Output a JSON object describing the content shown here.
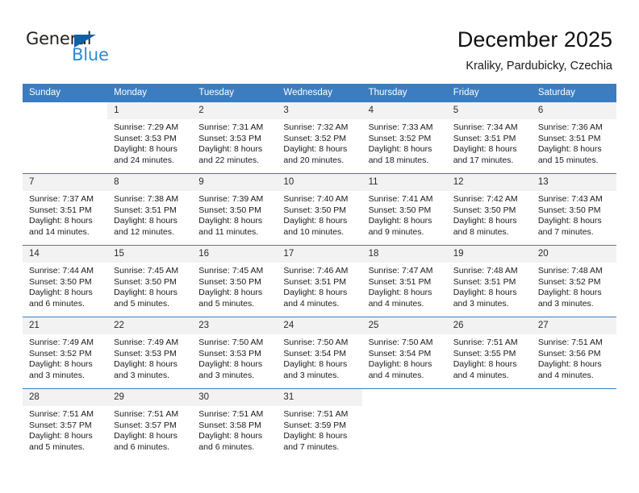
{
  "brand": {
    "name_part1": "General",
    "name_part2": "Blue",
    "accent_color": "#1060a8",
    "blue_text_color": "#2b8bd6"
  },
  "header": {
    "title": "December 2025",
    "subtitle": "Kraliky, Pardubicky, Czechia"
  },
  "calendar": {
    "header_bg": "#3b7dc0",
    "daynum_bg": "#f2f2f2",
    "weekdays": [
      "Sunday",
      "Monday",
      "Tuesday",
      "Wednesday",
      "Thursday",
      "Friday",
      "Saturday"
    ],
    "weeks": [
      [
        {
          "day": "",
          "blank": true,
          "sunrise": "",
          "sunset": "",
          "daylight1": "",
          "daylight2": ""
        },
        {
          "day": "1",
          "sunrise": "Sunrise: 7:29 AM",
          "sunset": "Sunset: 3:53 PM",
          "daylight1": "Daylight: 8 hours",
          "daylight2": "and 24 minutes."
        },
        {
          "day": "2",
          "sunrise": "Sunrise: 7:31 AM",
          "sunset": "Sunset: 3:53 PM",
          "daylight1": "Daylight: 8 hours",
          "daylight2": "and 22 minutes."
        },
        {
          "day": "3",
          "sunrise": "Sunrise: 7:32 AM",
          "sunset": "Sunset: 3:52 PM",
          "daylight1": "Daylight: 8 hours",
          "daylight2": "and 20 minutes."
        },
        {
          "day": "4",
          "sunrise": "Sunrise: 7:33 AM",
          "sunset": "Sunset: 3:52 PM",
          "daylight1": "Daylight: 8 hours",
          "daylight2": "and 18 minutes."
        },
        {
          "day": "5",
          "sunrise": "Sunrise: 7:34 AM",
          "sunset": "Sunset: 3:51 PM",
          "daylight1": "Daylight: 8 hours",
          "daylight2": "and 17 minutes."
        },
        {
          "day": "6",
          "sunrise": "Sunrise: 7:36 AM",
          "sunset": "Sunset: 3:51 PM",
          "daylight1": "Daylight: 8 hours",
          "daylight2": "and 15 minutes."
        }
      ],
      [
        {
          "day": "7",
          "sunrise": "Sunrise: 7:37 AM",
          "sunset": "Sunset: 3:51 PM",
          "daylight1": "Daylight: 8 hours",
          "daylight2": "and 14 minutes."
        },
        {
          "day": "8",
          "sunrise": "Sunrise: 7:38 AM",
          "sunset": "Sunset: 3:51 PM",
          "daylight1": "Daylight: 8 hours",
          "daylight2": "and 12 minutes."
        },
        {
          "day": "9",
          "sunrise": "Sunrise: 7:39 AM",
          "sunset": "Sunset: 3:50 PM",
          "daylight1": "Daylight: 8 hours",
          "daylight2": "and 11 minutes."
        },
        {
          "day": "10",
          "sunrise": "Sunrise: 7:40 AM",
          "sunset": "Sunset: 3:50 PM",
          "daylight1": "Daylight: 8 hours",
          "daylight2": "and 10 minutes."
        },
        {
          "day": "11",
          "sunrise": "Sunrise: 7:41 AM",
          "sunset": "Sunset: 3:50 PM",
          "daylight1": "Daylight: 8 hours",
          "daylight2": "and 9 minutes."
        },
        {
          "day": "12",
          "sunrise": "Sunrise: 7:42 AM",
          "sunset": "Sunset: 3:50 PM",
          "daylight1": "Daylight: 8 hours",
          "daylight2": "and 8 minutes."
        },
        {
          "day": "13",
          "sunrise": "Sunrise: 7:43 AM",
          "sunset": "Sunset: 3:50 PM",
          "daylight1": "Daylight: 8 hours",
          "daylight2": "and 7 minutes."
        }
      ],
      [
        {
          "day": "14",
          "sunrise": "Sunrise: 7:44 AM",
          "sunset": "Sunset: 3:50 PM",
          "daylight1": "Daylight: 8 hours",
          "daylight2": "and 6 minutes."
        },
        {
          "day": "15",
          "sunrise": "Sunrise: 7:45 AM",
          "sunset": "Sunset: 3:50 PM",
          "daylight1": "Daylight: 8 hours",
          "daylight2": "and 5 minutes."
        },
        {
          "day": "16",
          "sunrise": "Sunrise: 7:45 AM",
          "sunset": "Sunset: 3:50 PM",
          "daylight1": "Daylight: 8 hours",
          "daylight2": "and 5 minutes."
        },
        {
          "day": "17",
          "sunrise": "Sunrise: 7:46 AM",
          "sunset": "Sunset: 3:51 PM",
          "daylight1": "Daylight: 8 hours",
          "daylight2": "and 4 minutes."
        },
        {
          "day": "18",
          "sunrise": "Sunrise: 7:47 AM",
          "sunset": "Sunset: 3:51 PM",
          "daylight1": "Daylight: 8 hours",
          "daylight2": "and 4 minutes."
        },
        {
          "day": "19",
          "sunrise": "Sunrise: 7:48 AM",
          "sunset": "Sunset: 3:51 PM",
          "daylight1": "Daylight: 8 hours",
          "daylight2": "and 3 minutes."
        },
        {
          "day": "20",
          "sunrise": "Sunrise: 7:48 AM",
          "sunset": "Sunset: 3:52 PM",
          "daylight1": "Daylight: 8 hours",
          "daylight2": "and 3 minutes."
        }
      ],
      [
        {
          "day": "21",
          "sunrise": "Sunrise: 7:49 AM",
          "sunset": "Sunset: 3:52 PM",
          "daylight1": "Daylight: 8 hours",
          "daylight2": "and 3 minutes."
        },
        {
          "day": "22",
          "sunrise": "Sunrise: 7:49 AM",
          "sunset": "Sunset: 3:53 PM",
          "daylight1": "Daylight: 8 hours",
          "daylight2": "and 3 minutes."
        },
        {
          "day": "23",
          "sunrise": "Sunrise: 7:50 AM",
          "sunset": "Sunset: 3:53 PM",
          "daylight1": "Daylight: 8 hours",
          "daylight2": "and 3 minutes."
        },
        {
          "day": "24",
          "sunrise": "Sunrise: 7:50 AM",
          "sunset": "Sunset: 3:54 PM",
          "daylight1": "Daylight: 8 hours",
          "daylight2": "and 3 minutes."
        },
        {
          "day": "25",
          "sunrise": "Sunrise: 7:50 AM",
          "sunset": "Sunset: 3:54 PM",
          "daylight1": "Daylight: 8 hours",
          "daylight2": "and 4 minutes."
        },
        {
          "day": "26",
          "sunrise": "Sunrise: 7:51 AM",
          "sunset": "Sunset: 3:55 PM",
          "daylight1": "Daylight: 8 hours",
          "daylight2": "and 4 minutes."
        },
        {
          "day": "27",
          "sunrise": "Sunrise: 7:51 AM",
          "sunset": "Sunset: 3:56 PM",
          "daylight1": "Daylight: 8 hours",
          "daylight2": "and 4 minutes."
        }
      ],
      [
        {
          "day": "28",
          "sunrise": "Sunrise: 7:51 AM",
          "sunset": "Sunset: 3:57 PM",
          "daylight1": "Daylight: 8 hours",
          "daylight2": "and 5 minutes."
        },
        {
          "day": "29",
          "sunrise": "Sunrise: 7:51 AM",
          "sunset": "Sunset: 3:57 PM",
          "daylight1": "Daylight: 8 hours",
          "daylight2": "and 6 minutes."
        },
        {
          "day": "30",
          "sunrise": "Sunrise: 7:51 AM",
          "sunset": "Sunset: 3:58 PM",
          "daylight1": "Daylight: 8 hours",
          "daylight2": "and 6 minutes."
        },
        {
          "day": "31",
          "sunrise": "Sunrise: 7:51 AM",
          "sunset": "Sunset: 3:59 PM",
          "daylight1": "Daylight: 8 hours",
          "daylight2": "and 7 minutes."
        },
        {
          "day": "",
          "blank": true,
          "sunrise": "",
          "sunset": "",
          "daylight1": "",
          "daylight2": ""
        },
        {
          "day": "",
          "blank": true,
          "sunrise": "",
          "sunset": "",
          "daylight1": "",
          "daylight2": ""
        },
        {
          "day": "",
          "blank": true,
          "sunrise": "",
          "sunset": "",
          "daylight1": "",
          "daylight2": ""
        }
      ]
    ]
  }
}
